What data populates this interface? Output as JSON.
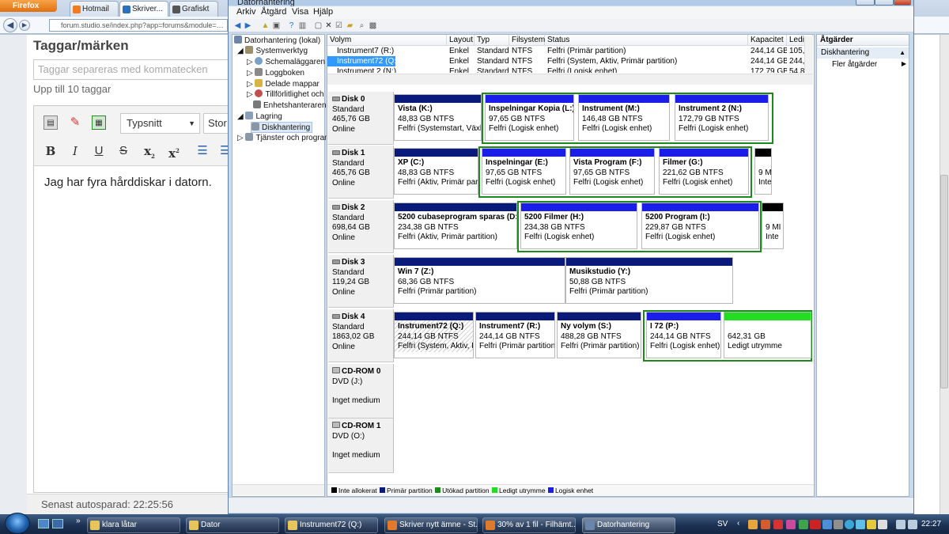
{
  "browser": {
    "brand": "Firefox",
    "tabs": [
      "Hotmail ...",
      "Skriver...",
      "Grafiskt F..."
    ],
    "url": "forum.studio.se/index.php?app=forums&module=post"
  },
  "webpage": {
    "tags_title": "Taggar/märken",
    "tags_placeholder": "Taggar separeras med kommatecken",
    "tags_hint": "Upp till 10 taggar",
    "font_select": "Typsnitt",
    "size_select": "Stor",
    "editor_text": "Jag har fyra hårddiskar i datorn.",
    "autosave": "Senast autosparad: 22:25:56",
    "bold": "B",
    "italic": "I",
    "underline": "U",
    "strike": "S",
    "sub": "x",
    "sup": "x"
  },
  "window": {
    "title": "Datorhantering",
    "menu": [
      "Arkiv",
      "Åtgärd",
      "Visa",
      "Hjälp"
    ]
  },
  "tree": {
    "root": "Datorhantering (lokal)",
    "items": [
      "Systemverktyg",
      "Schemaläggaren",
      "Loggboken",
      "Delade mappar",
      "Tillförlitlighet och",
      "Enhetshanteraren",
      "Lagring",
      "Diskhantering",
      "Tjänster och program"
    ]
  },
  "volume_list": {
    "headers": [
      "Volym",
      "Layout",
      "Typ",
      "Filsystem",
      "Status",
      "Kapacitet",
      "Ledi"
    ],
    "rows": [
      [
        "Instrument7 (R:)",
        "Enkel",
        "Standard",
        "NTFS",
        "Felfri (Primär partition)",
        "244,14 GB",
        "105,"
      ],
      [
        "Instrument72 (Q:)",
        "Enkel",
        "Standard",
        "NTFS",
        "Felfri (System, Aktiv, Primär partition)",
        "244,14 GB",
        "244,"
      ],
      [
        "Instrument 2 (N:)",
        "Enkel",
        "Standard",
        "NTFS",
        "Felfri (Logisk enhet)",
        "172,79 GB",
        "54,8"
      ]
    ]
  },
  "disks": [
    {
      "name": "Disk 0",
      "type": "Standard",
      "size": "465,76 GB",
      "state": "Online",
      "volumes": [
        {
          "name": "Vista (K:)",
          "size": "48,83 GB NTFS",
          "status": "Felfri (Systemstart, Växlin"
        },
        {
          "name": "Inspelningar Kopia (L:)",
          "size": "97,65 GB NTFS",
          "status": "Felfri (Logisk enhet)"
        },
        {
          "name": "Instrument (M:)",
          "size": "146,48 GB NTFS",
          "status": "Felfri (Logisk enhet)"
        },
        {
          "name": "Instrument 2 (N:)",
          "size": "172,79 GB NTFS",
          "status": "Felfri (Logisk enhet)"
        }
      ]
    },
    {
      "name": "Disk 1",
      "type": "Standard",
      "size": "465,76 GB",
      "state": "Online",
      "volumes": [
        {
          "name": "XP (C:)",
          "size": "48,83 GB NTFS",
          "status": "Felfri (Aktiv, Primär part"
        },
        {
          "name": "Inspelningar (E:)",
          "size": "97,65 GB NTFS",
          "status": "Felfri (Logisk enhet)"
        },
        {
          "name": "Vista Program (F:)",
          "size": "97,65 GB NTFS",
          "status": "Felfri (Logisk enhet)"
        },
        {
          "name": "Filmer (G:)",
          "size": "221,62 GB NTFS",
          "status": "Felfri (Logisk enhet)"
        },
        {
          "name": "",
          "size": "9 M",
          "status": "Inte"
        }
      ]
    },
    {
      "name": "Disk 2",
      "type": "Standard",
      "size": "698,64 GB",
      "state": "Online",
      "volumes": [
        {
          "name": "5200 cubaseprogram sparas (D:)",
          "size": "234,38 GB NTFS",
          "status": "Felfri (Aktiv, Primär partition)"
        },
        {
          "name": "5200 Filmer (H:)",
          "size": "234,38 GB NTFS",
          "status": "Felfri (Logisk enhet)"
        },
        {
          "name": "5200 Program (I:)",
          "size": "229,87 GB NTFS",
          "status": "Felfri (Logisk enhet)"
        },
        {
          "name": "",
          "size": "9 MI",
          "status": "Inte"
        }
      ]
    },
    {
      "name": "Disk 3",
      "type": "Standard",
      "size": "119,24 GB",
      "state": "Online",
      "volumes": [
        {
          "name": "Win 7 (Z:)",
          "size": "68,36 GB NTFS",
          "status": "Felfri (Primär partition)"
        },
        {
          "name": "Musikstudio (Y:)",
          "size": "50,88 GB NTFS",
          "status": "Felfri (Primär partition)"
        }
      ]
    },
    {
      "name": "Disk 4",
      "type": "Standard",
      "size": "1863,02 GB",
      "state": "Online",
      "volumes": [
        {
          "name": "Instrument72 (Q:)",
          "size": "244,14 GB NTFS",
          "status": "Felfri (System, Aktiv, Pr"
        },
        {
          "name": "Instrument7 (R:)",
          "size": "244,14 GB NTFS",
          "status": "Felfri (Primär partition"
        },
        {
          "name": "Ny volym (S:)",
          "size": "488,28 GB NTFS",
          "status": "Felfri (Primär partition)"
        },
        {
          "name": "I 72 (P:)",
          "size": "244,14 GB NTFS",
          "status": "Felfri (Logisk enhet)"
        },
        {
          "name": "",
          "size": "642,31 GB",
          "status": "Ledigt utrymme"
        }
      ]
    }
  ],
  "cdroms": [
    {
      "name": "CD-ROM 0",
      "type": "DVD (J:)",
      "state": "Inget medium"
    },
    {
      "name": "CD-ROM 1",
      "type": "DVD (O:)",
      "state": "Inget medium"
    }
  ],
  "legend": [
    "Inte allokerat",
    "Primär partition",
    "Utökad partition",
    "Ledigt utrymme",
    "Logisk enhet"
  ],
  "colors": {
    "primary": "#0a1a7a",
    "logical": "#1a1ee8",
    "extended": "#1d8a1d",
    "free": "#22dd22",
    "unallocated": "#000000"
  },
  "actions": {
    "title": "Åtgärder",
    "section": "Diskhantering",
    "more": "Fler åtgärder"
  },
  "taskbar": {
    "items": [
      "klara låtar",
      "Dator",
      "Instrument72 (Q:)",
      "Skriver nytt ämne - St...",
      "30% av 1 fil - Filhämt...",
      "Datorhantering"
    ],
    "lang": "SV",
    "clock": "22:27"
  }
}
